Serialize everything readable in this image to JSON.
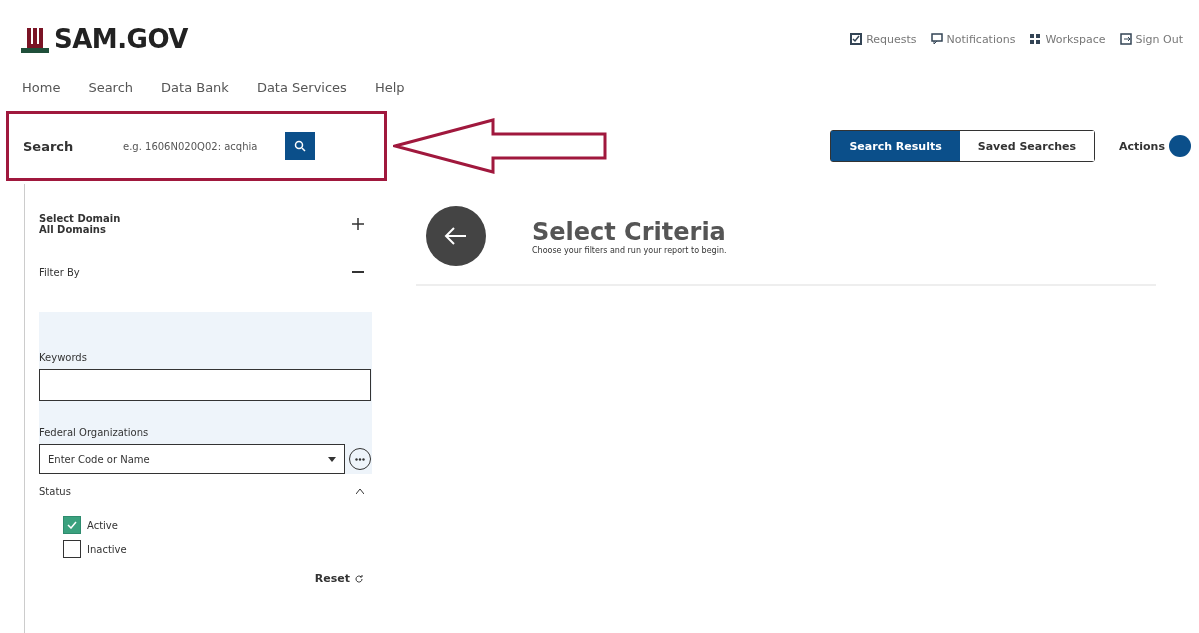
{
  "header": {
    "logo": "SAM.GOV",
    "links": [
      {
        "kind": "requests",
        "label": "Requests"
      },
      {
        "kind": "notifications",
        "label": "Notifications"
      },
      {
        "kind": "workspace",
        "label": "Workspace"
      },
      {
        "kind": "signout",
        "label": "Sign Out"
      }
    ]
  },
  "nav": [
    "Home",
    "Search",
    "Data Bank",
    "Data Services",
    "Help"
  ],
  "search": {
    "label": "Search",
    "placeholder": "e.g. 1606N020Q02: acqhia"
  },
  "views": [
    {
      "label": "Search Results",
      "selected": true
    },
    {
      "label": "Saved Searches",
      "selected": false
    }
  ],
  "actions": "Actions",
  "sidebar": {
    "domain": {
      "title": "Select Domain",
      "value": "All Domains"
    },
    "filter_title": "Filter By",
    "keywords": {
      "label": "Keywords"
    },
    "organizations": {
      "label": "Federal Organizations",
      "placeholder": "Enter Code or Name"
    },
    "status": {
      "label": "Status",
      "options": [
        {
          "label": "Active",
          "checked": true
        },
        {
          "label": "Inactive",
          "checked": false
        }
      ]
    },
    "reset": "Reset"
  },
  "main": {
    "title": "Select Criteria",
    "subtitle": "Choose your filters and run your report to begin."
  }
}
